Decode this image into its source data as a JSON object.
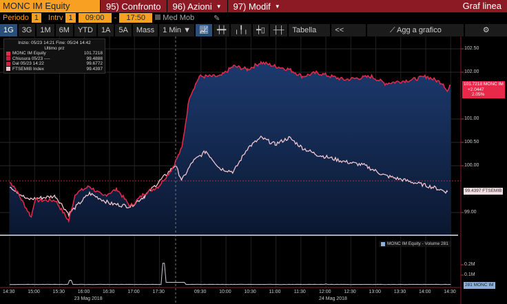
{
  "header": {
    "ticker": "MONC IM Equity",
    "compare": "95) Confronto",
    "actions": "96) Azioni",
    "modify": "97) Modif",
    "chart_type": "Graf linea"
  },
  "controls": {
    "period_label": "Periodo",
    "period_value": "1",
    "interval_label": "Intrv",
    "interval_value": "1",
    "start_time": "09:00",
    "separator": "-",
    "end_time": "17:50",
    "moving_avg": "Med Mob"
  },
  "ranges": [
    "1G",
    "3G",
    "1M",
    "6M",
    "YTD",
    "1A",
    "5A",
    "Mass",
    "1 Min ▼"
  ],
  "toolbar": {
    "table": "Tabella",
    "collapse": "<<",
    "add_chart": "Agg a grafico",
    "settings": "⚙"
  },
  "legend": {
    "range": "Inizio: 05/23 14:21 Fine: 05/24 14:42",
    "subtitle": "Ultimo prz",
    "items": [
      {
        "label": "MONC IM Equity",
        "value": "101.7218",
        "color": "#e8294a"
      },
      {
        "label": "Chiusura 05/23 ----",
        "value": "99.4888",
        "color": "#c8203c"
      },
      {
        "label": "Dal 05/23 14:22",
        "value": "99.6772",
        "color": "#d02040"
      },
      {
        "label": "FTSEMIB Index",
        "value": "99.4397",
        "color": "#f2c6cf"
      }
    ]
  },
  "tags": {
    "monc_line1": "101.7218 MONC IM",
    "monc_line2": "+2.0447",
    "monc_line3": "2.05%",
    "ftse": "99.4397 FTSEMIB",
    "volume": "281 MONC IM"
  },
  "volume_legend": "MONC IM Equity - Volume 281",
  "chart_data": {
    "type": "line",
    "title": "MONC IM Equity vs FTSEMIB Index (normalized)",
    "x_unit": "minutes of session from 23 May 14:30 (day 2 starts at 200 = 09:00)",
    "yticks": [
      "102.50",
      "102.00",
      "101.00",
      "100.50",
      "100.00",
      "99.00"
    ],
    "ytick_values": [
      102.5,
      102,
      101,
      100.5,
      100,
      99
    ],
    "ylim": [
      98.6,
      102.7
    ],
    "xticks": [
      "14:30",
      "15:00",
      "15:30",
      "16:00",
      "16:30",
      "17:00",
      "17:30",
      "09:30",
      "10:00",
      "10:30",
      "11:00",
      "11:30",
      "12:00",
      "12:30",
      "13:00",
      "13:30",
      "14:00",
      "14:30"
    ],
    "xtick_minutes": [
      0,
      30,
      60,
      90,
      120,
      150,
      180,
      230,
      260,
      290,
      320,
      350,
      380,
      410,
      440,
      470,
      500,
      530
    ],
    "date_labels": [
      "23 Mag 2018",
      "24 Mag 2018"
    ],
    "reference_lines": [
      {
        "name": "Dal 05/23 14:22",
        "value": 99.6772
      }
    ],
    "series": [
      {
        "name": "MONC IM Equity",
        "color": "#e8294a",
        "points": [
          [
            0,
            99.65
          ],
          [
            5,
            99.57
          ],
          [
            26,
            98.9
          ],
          [
            30,
            99.26
          ],
          [
            55,
            99.26
          ],
          [
            71,
            98.82
          ],
          [
            79,
            99.41
          ],
          [
            96,
            99.56
          ],
          [
            112,
            99.35
          ],
          [
            129,
            99.5
          ],
          [
            145,
            99.13
          ],
          [
            162,
            99.41
          ],
          [
            179,
            99.56
          ],
          [
            195,
            99.93
          ],
          [
            207,
            100.38
          ],
          [
            216,
            101.47
          ],
          [
            228,
            101.91
          ],
          [
            253,
            101.91
          ],
          [
            269,
            102.13
          ],
          [
            286,
            102.06
          ],
          [
            302,
            102.21
          ],
          [
            319,
            102.13
          ],
          [
            336,
            102.06
          ],
          [
            352,
            101.91
          ],
          [
            369,
            101.99
          ],
          [
            402,
            101.84
          ],
          [
            435,
            101.91
          ],
          [
            451,
            101.76
          ],
          [
            484,
            101.84
          ],
          [
            501,
            101.91
          ],
          [
            521,
            101.76
          ],
          [
            526,
            101.59
          ],
          [
            530,
            101.72
          ]
        ]
      },
      {
        "name": "FTSEMIB Index",
        "color": "#f2c6cf",
        "points": [
          [
            0,
            99.57
          ],
          [
            21,
            99.28
          ],
          [
            55,
            99.35
          ],
          [
            71,
            98.97
          ],
          [
            96,
            99.41
          ],
          [
            121,
            99.19
          ],
          [
            145,
            99.13
          ],
          [
            162,
            99.35
          ],
          [
            179,
            99.65
          ],
          [
            199,
            100.01
          ],
          [
            207,
            99.69
          ],
          [
            220,
            100.09
          ],
          [
            236,
            100.31
          ],
          [
            253,
            99.94
          ],
          [
            269,
            99.87
          ],
          [
            286,
            100.38
          ],
          [
            302,
            100.6
          ],
          [
            319,
            100.46
          ],
          [
            336,
            100.6
          ],
          [
            352,
            100.38
          ],
          [
            369,
            100.24
          ],
          [
            402,
            100.09
          ],
          [
            426,
            100.01
          ],
          [
            451,
            99.79
          ],
          [
            484,
            99.65
          ],
          [
            509,
            99.54
          ],
          [
            526,
            99.44
          ]
        ]
      }
    ],
    "volume": {
      "name": "MONC IM Equity - Volume",
      "yticks": [
        "0.2M",
        "0.1M"
      ],
      "ytick_values": [
        200000,
        100000
      ],
      "spikes": [
        [
          73,
          50000
        ],
        [
          185,
          215000
        ],
        [
          380,
          15000
        ]
      ],
      "baseline": 8000
    }
  }
}
